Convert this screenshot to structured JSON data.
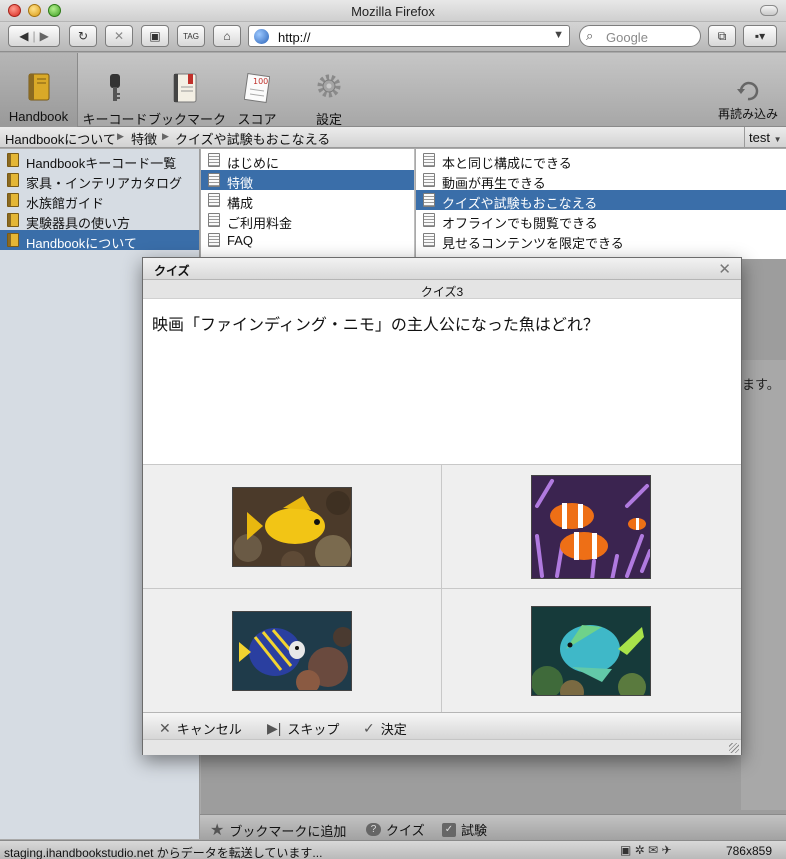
{
  "window": {
    "title": "Mozilla Firefox"
  },
  "nav": {
    "url": "http://",
    "search_placeholder": "Google"
  },
  "toolbar": {
    "items": [
      {
        "label": "Handbook",
        "icon": "handbook-icon"
      },
      {
        "label": "キーコード",
        "icon": "key-icon"
      },
      {
        "label": "ブックマーク",
        "icon": "bookmark-icon"
      },
      {
        "label": "スコア",
        "icon": "score-icon"
      },
      {
        "label": "設定",
        "icon": "gear-icon"
      }
    ],
    "reload_label": "再読み込み"
  },
  "breadcrumb": {
    "items": [
      "Handbookについて",
      "特徴",
      "クイズや試験もおこなえる"
    ],
    "select_value": "test"
  },
  "sidebar": {
    "items": [
      {
        "label": "Handbookキーコード一覧",
        "selected": false
      },
      {
        "label": "家具・インテリアカタログ",
        "selected": false
      },
      {
        "label": "水族館ガイド",
        "selected": false
      },
      {
        "label": "実験器具の使い方",
        "selected": false
      },
      {
        "label": "Handbookについて",
        "selected": true
      }
    ]
  },
  "chapters": {
    "items": [
      {
        "label": "はじめに",
        "selected": false
      },
      {
        "label": "特徴",
        "selected": true
      },
      {
        "label": "構成",
        "selected": false
      },
      {
        "label": "ご利用料金",
        "selected": false
      },
      {
        "label": "FAQ",
        "selected": false
      }
    ]
  },
  "pages": {
    "items": [
      {
        "label": "本と同じ構成にできる",
        "selected": false
      },
      {
        "label": "動画が再生できる",
        "selected": false
      },
      {
        "label": "クイズや試験もおこなえる",
        "selected": true
      },
      {
        "label": "オフラインでも閲覧できる",
        "selected": false
      },
      {
        "label": "見せるコンテンツを限定できる",
        "selected": false
      }
    ]
  },
  "background_text": "ます。",
  "quiz": {
    "title": "クイズ",
    "subtitle": "クイズ3",
    "question": "映画「ファインディング・ニモ」の主人公になった魚はどれ？",
    "choices": [
      {
        "image": "yellow-fish"
      },
      {
        "image": "clownfish"
      },
      {
        "image": "emperor-angelfish"
      },
      {
        "image": "blue-green-fish"
      }
    ],
    "cancel_label": "キャンセル",
    "skip_label": "スキップ",
    "decide_label": "決定"
  },
  "bottombar": {
    "bookmark_label": "ブックマークに追加",
    "quiz_label": "クイズ",
    "exam_label": "試験"
  },
  "status": {
    "text": "staging.ihandbookstudio.net からデータを転送しています...",
    "dims": "786x859"
  },
  "colors": {
    "selection": "#3a6ea9",
    "sidebar_bg": "#d6dce3"
  }
}
